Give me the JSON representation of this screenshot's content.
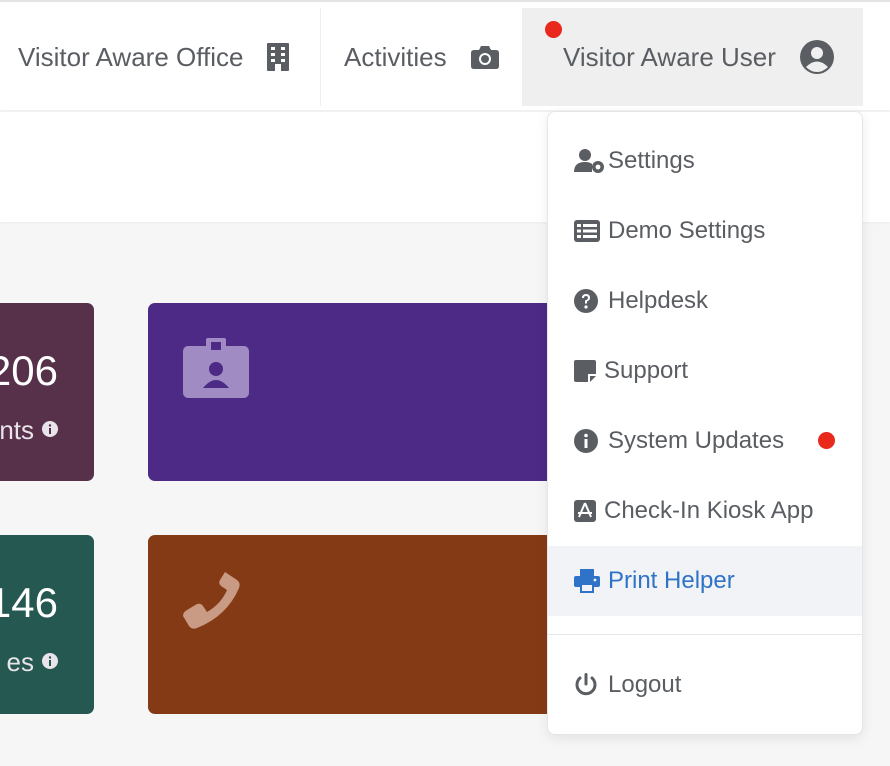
{
  "navbar": {
    "office_label": "Visitor Aware Office",
    "activities_label": "Activities",
    "user_label": "Visitor Aware User"
  },
  "cards": [
    {
      "number": "206",
      "label_fragment": "nts",
      "color": "#57304a"
    },
    {
      "icon": "id-badge-icon",
      "color": "#4c2a86"
    },
    {
      "number": "146",
      "label_fragment": "es",
      "color": "#245850"
    },
    {
      "icon": "phone-icon",
      "color": "#843b15"
    }
  ],
  "user_menu": {
    "items": [
      {
        "label": "Settings",
        "icon": "user-gear-icon"
      },
      {
        "label": "Demo Settings",
        "icon": "list-icon"
      },
      {
        "label": "Helpdesk",
        "icon": "question-circle-icon"
      },
      {
        "label": "Support",
        "icon": "sticky-note-icon"
      },
      {
        "label": "System Updates",
        "icon": "info-circle-icon",
        "notification": true
      },
      {
        "label": "Check-In Kiosk App",
        "icon": "app-store-icon"
      },
      {
        "label": "Print Helper",
        "icon": "printer-icon",
        "highlighted": true
      },
      {
        "label": "Logout",
        "icon": "power-icon"
      }
    ]
  },
  "colors": {
    "notification": "#e8291c",
    "link_active": "#2f73c9"
  }
}
